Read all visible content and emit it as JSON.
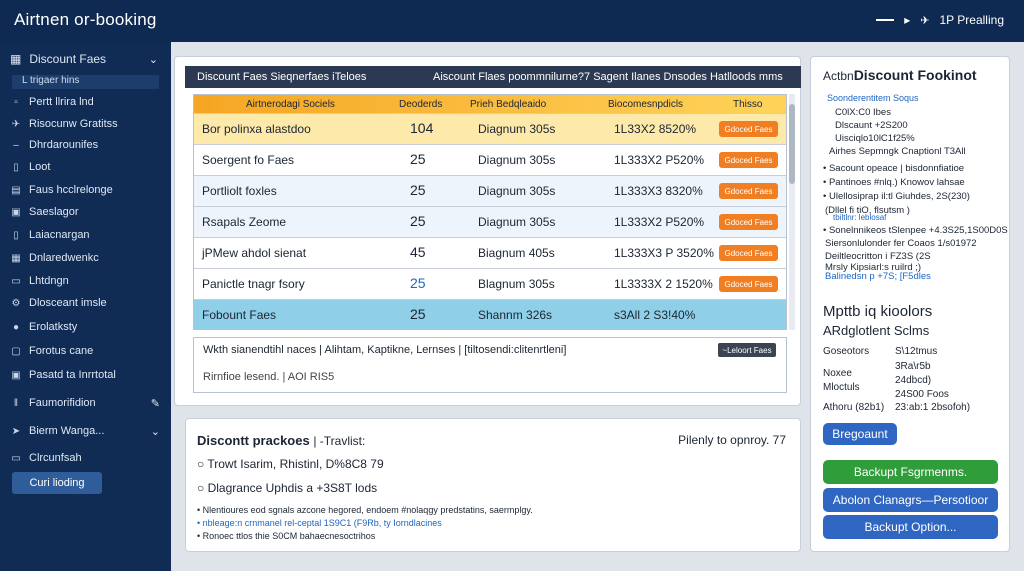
{
  "app": {
    "title": "Airtnen or-booking",
    "right_label": "1P Prealling"
  },
  "sidebar": {
    "head": "Discount Faes",
    "sub": "L trigaer hins",
    "items": [
      {
        "label": "Pertt llrira lnd",
        "icon": "user-icon"
      },
      {
        "label": "Risocunw Gratitss",
        "icon": "plane-icon"
      },
      {
        "label": "Dhrdarounifes",
        "icon": "list-icon"
      },
      {
        "label": "Loot",
        "icon": "document-icon"
      },
      {
        "label": "Faus hcclrelonge",
        "icon": "grid-icon"
      },
      {
        "label": "Saeslagor",
        "icon": "window-icon"
      },
      {
        "label": "Laiacnargan",
        "icon": "phone-icon"
      },
      {
        "label": "Dnlaredwenkc",
        "icon": "table-icon"
      },
      {
        "label": "Lhtdngn",
        "icon": "card-icon"
      },
      {
        "label": "Dlosceant imsle",
        "icon": "gear-icon"
      },
      {
        "label": "Erolatksty",
        "icon": "people-icon"
      },
      {
        "label": "Forotus cane",
        "icon": "lock-icon"
      },
      {
        "label": "Pasatd ta Inrrtotal",
        "icon": "monitor-icon"
      }
    ],
    "section": "Faumorifidion",
    "section2": "Bierm Wanga...",
    "bottom_item": "Clrcunfsah",
    "button": "Curi lioding"
  },
  "main": {
    "header_left": "Discount Faes Sieqnerfaes iTeloes",
    "header_right": "Aiscount Flaes poommnilurne?7 Sagent Ilanes Dnsodes Hatlloods mms",
    "columns": [
      "Airtnerodagi Sociels",
      "Deoderds",
      "Prieh Bedqleaido",
      "Biocomesnpdicls",
      "Thisso"
    ],
    "rows": [
      {
        "name": "Bor polinxa alastdoo",
        "num": "104",
        "plan": "Diagnum 305s",
        "code": "1L33X2 8520%",
        "btn": "Gdoced Faes"
      },
      {
        "name": "Soergent fo Faes",
        "num": "25",
        "plan": "Diagnum 305s",
        "code": "1L333X2 P520%",
        "btn": "Gdoced Faes"
      },
      {
        "name": "Portliolt foxles",
        "num": "25",
        "plan": "Diagnum 305s",
        "code": "1L333X3 8320%",
        "btn": "Gdoced Faes"
      },
      {
        "name": "Rsapals Zeome",
        "num": "25",
        "plan": "Diagnum 305s",
        "code": "1L333X2 P520%",
        "btn": "Gdoced Faes"
      },
      {
        "name": "jPMew ahdol sienat",
        "num": "45",
        "plan": "Biagnum 405s",
        "code": "1L333X3 P 3520%",
        "btn": "Gdoced Faes"
      },
      {
        "name": "Panictle tnagr fsory",
        "num": "25",
        "plan": "Blagnum 305s",
        "code": "1L3333X 2 1520%",
        "btn": "Gdoced Faes"
      },
      {
        "name": "Fobount Faes",
        "num": "25",
        "plan": "Shannm 326s",
        "code": "s3All 2 S3!40%",
        "btn": ""
      }
    ],
    "info_line": "Wkth sianendtihl naces | Alihtam, Kaptikne, Lernses | [tiltosendi:clitenrtleni]",
    "info_button": "~Leloort Faes",
    "info_line2": "Rirnfioe lesend. | AOI RIS5"
  },
  "bottom": {
    "title": "Discontt prackoes",
    "title_tail": "| -Travlist:",
    "right": "Pilenly to opnroy.  77",
    "line1": "Trowt Isarim, Rhistinl, D%8C8 79",
    "line2": "Dlagrance Uphdis a +3S8T lods",
    "small1": "Nlentioures eod sgnals azcone hegored, endoem #nolaqgy predstatins, saermplgy.",
    "small2": "nbleage:n crnmanel rel-ceptal 1S9C1 (F9Rb, ty Iorndlacines",
    "small3": "Ronoec ttlos thie S0CM bahaecnesoctrihos"
  },
  "right_panel": {
    "title_small": "Actbn",
    "title": "Discount Fookinot",
    "blue_line": "Soonderentitem Soqus",
    "lines": [
      "C0lX:C0 Ibes",
      "Dlscaunt +2S200",
      "Uisciqlo10lC1f25%",
      "Airhes Sepmngk Cnaptionl  T3All"
    ],
    "bullets": [
      "Sacount opeace | bisdonnfiatioe",
      "Pantinoes #nlq.) Knowov lahsae",
      "Ulellosiprap il:tl Giuhdes,  2S(230)",
      "(Dllel  fi tiO, flsutsm )"
    ],
    "blue_small": "tbiltlnr: leblosaf",
    "lines2": [
      "Sonelnnikeos tSlenpee +4.3S25,1S00D0S",
      "Siersonlulonder fer Coaos  1/s01972",
      "Deiltleocritton  i FZ3S (2S",
      "Mrsly Kipsiarl:s ruilrd ;)",
      "Balinedsn p +7S; [F5dles"
    ],
    "heading": "Mpttb iq kioolors",
    "subheading": "ARdglotlent Sclms",
    "kv": [
      {
        "k": "Goseotors",
        "v": "S\\12tmus"
      },
      {
        "k": "",
        "v": "3Ra\\r5b"
      },
      {
        "k": "Noxee",
        "v": "24dbcd)"
      },
      {
        "k": "Mloctuls",
        "v": "24S00 Foos"
      },
      {
        "k": "Athoru (82b1)",
        "v": "23:ab:1 2bsofoh)"
      }
    ],
    "button1": "Bregoaunt",
    "button2": "Backupt Fsgrmenms.",
    "button3": "Abolon  Clanagrs—Persotioor",
    "button4": "Backupt Option..."
  }
}
